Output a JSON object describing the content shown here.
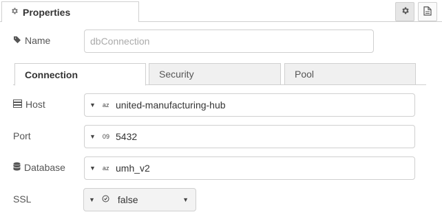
{
  "header": {
    "tab_title": "Properties",
    "tab_icon": "gear-icon",
    "buttons": [
      {
        "name": "settings",
        "icon": "gear-icon"
      },
      {
        "name": "description",
        "icon": "document-icon"
      }
    ]
  },
  "name_field": {
    "label": "Name",
    "icon": "tag-icon",
    "placeholder": "dbConnection",
    "value": ""
  },
  "subtabs": [
    {
      "label": "Connection",
      "active": true
    },
    {
      "label": "Security",
      "active": false
    },
    {
      "label": "Pool",
      "active": false
    }
  ],
  "connection": {
    "host": {
      "label": "Host",
      "icon": "server-icon",
      "type": "a-z",
      "value": "united-manufacturing-hub"
    },
    "port": {
      "label": "Port",
      "type": "0-9",
      "value": "5432"
    },
    "database": {
      "label": "Database",
      "icon": "database-icon",
      "type": "a-z",
      "value": "umh_v2"
    },
    "ssl": {
      "label": "SSL",
      "type": "boolean",
      "value": "false"
    }
  }
}
